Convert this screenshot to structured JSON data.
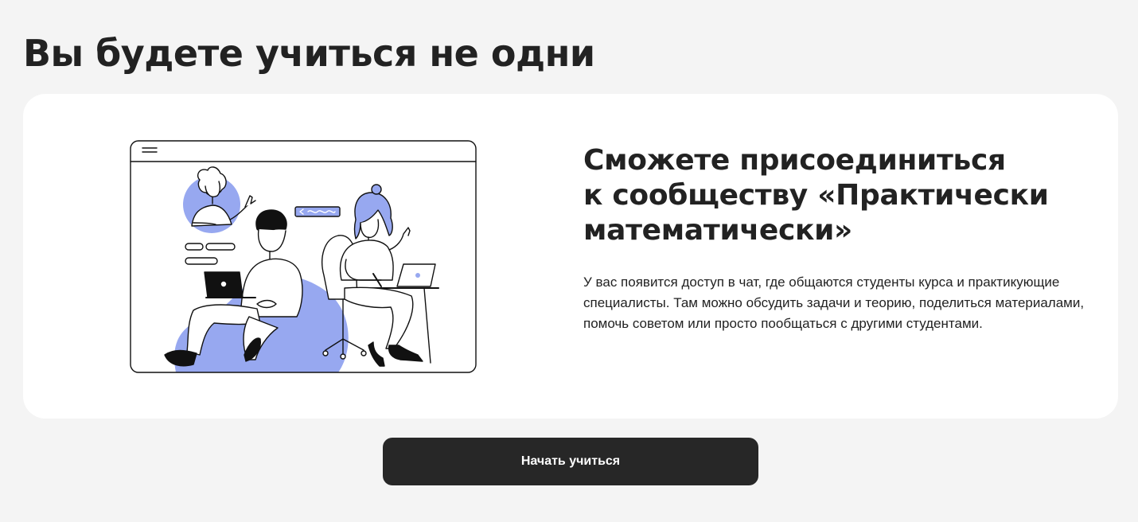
{
  "section": {
    "title": "Вы будете учиться не одни"
  },
  "card": {
    "heading_lines": [
      "Сможете присоединиться",
      "к сообществу «Практически",
      "математически»"
    ],
    "text": "У вас появится доступ в чат, где общаются студенты курса и практикующие специалисты. Там можно обсудить задачи и теорию, поделиться материалами, помочь советом или просто пообщаться с другими студентами.",
    "illustration_icon": "community-illustration"
  },
  "cta": {
    "label": "Начать учиться"
  },
  "colors": {
    "page_background": "#f4f4f4",
    "card_background": "#ffffff",
    "accent": "#97a8f0",
    "button_background": "#272727",
    "text": "#222222"
  }
}
